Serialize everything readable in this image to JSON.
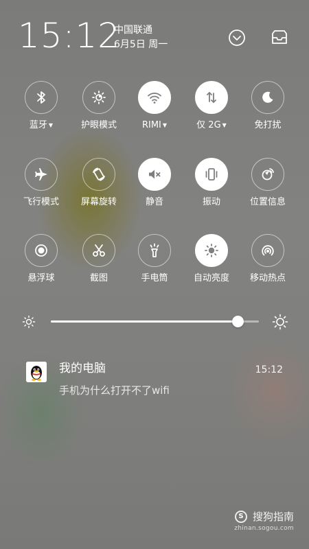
{
  "status": {
    "time": "15:12",
    "carrier": "中国联通",
    "date": "6月5日 周一",
    "icons": [
      "chevron-down-circle-icon",
      "inbox-tray-icon"
    ]
  },
  "tiles": [
    {
      "label": "蓝牙",
      "dropdown": true,
      "icon": "bluetooth-icon",
      "active": false
    },
    {
      "label": "护眼模式",
      "dropdown": false,
      "icon": "eye-care-icon",
      "active": false
    },
    {
      "label": "RIMI",
      "dropdown": true,
      "icon": "wifi-icon",
      "active": true
    },
    {
      "label": "仅 2G",
      "dropdown": true,
      "icon": "mobile-data-icon",
      "active": true
    },
    {
      "label": "免打扰",
      "dropdown": false,
      "icon": "moon-icon",
      "active": false
    },
    {
      "label": "飞行模式",
      "dropdown": false,
      "icon": "airplane-icon",
      "active": false
    },
    {
      "label": "屏幕旋转",
      "dropdown": false,
      "icon": "rotate-icon",
      "active": false
    },
    {
      "label": "静音",
      "dropdown": false,
      "icon": "mute-icon",
      "active": true
    },
    {
      "label": "振动",
      "dropdown": false,
      "icon": "vibrate-icon",
      "active": true
    },
    {
      "label": "位置信息",
      "dropdown": false,
      "icon": "location-icon",
      "active": false
    },
    {
      "label": "悬浮球",
      "dropdown": false,
      "icon": "floating-ball-icon",
      "active": false
    },
    {
      "label": "截图",
      "dropdown": false,
      "icon": "scissors-icon",
      "active": false
    },
    {
      "label": "手电筒",
      "dropdown": false,
      "icon": "flashlight-icon",
      "active": false
    },
    {
      "label": "自动亮度",
      "dropdown": false,
      "icon": "auto-brightness-icon",
      "active": true
    },
    {
      "label": "移动热点",
      "dropdown": false,
      "icon": "hotspot-icon",
      "active": false
    }
  ],
  "brightness": {
    "level": 0.9
  },
  "notification": {
    "title": "我的电脑",
    "time": "15:12",
    "body": "手机为什么打开不了wifi",
    "app_icon": "qq-penguin-icon"
  },
  "watermark": {
    "name": "搜狗指南",
    "url": "zhinan.sogou.com"
  },
  "colors": {
    "active_circle": "#ffffff",
    "active_icon": "#7e7e7c",
    "text": "#ffffff"
  }
}
